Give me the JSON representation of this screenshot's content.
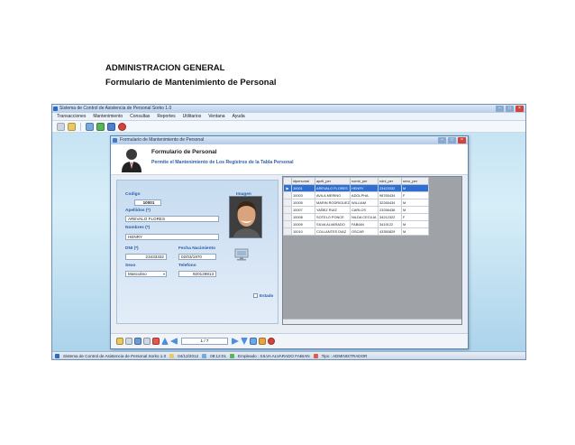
{
  "document": {
    "heading": "ADMINISTRACION GENERAL",
    "subheading": "Formulario de Mantenimiento de Personal"
  },
  "app": {
    "title": "Sistema de Control de Asistencia de Personal Sorko 1.0",
    "menu": [
      "Transacciones",
      "Mantenimiento",
      "Consultas",
      "Reportes",
      "Utilitarios",
      "Ventana",
      "Ayuda"
    ]
  },
  "form": {
    "window_title": "Formulario de Mantenimiento de Personal",
    "header_title": "Formulario de Personal",
    "header_subtitle": "Permite el Mantenimiento de Los Registros de la Tabla Personal",
    "labels": {
      "codigo": "Codigo",
      "apellidos": "Apellidos (*)",
      "nombres": "Nombres (*)",
      "dni": "DNI (*)",
      "fecha_nacimiento": "Fecha Nacimiento",
      "sexo": "Sexo",
      "telefono": "Telefono",
      "imagen": "Imagen",
      "estado": "Estado"
    },
    "values": {
      "codigo": "10001",
      "apellidos": "AREVALO FLORES",
      "nombres": "HENRY",
      "dni": "23433332",
      "fecha_nacimiento": "02/03/1970",
      "sexo": "Masculino",
      "telefono": "920129813"
    },
    "nav_counter": "1 / 7"
  },
  "grid": {
    "columns": [
      "idpersonal",
      "apell_per",
      "nomb_per",
      "ndni_per",
      "sexo_per"
    ],
    "rows": [
      [
        "10001",
        "AREVALO FLORES",
        "HENRY",
        "23423332",
        "M"
      ],
      [
        "10003",
        "AVILA MERINO",
        "ADOLPHA",
        "98765434",
        "F"
      ],
      [
        "10005",
        "MARIN RODRIGUEZ",
        "WILLIAM",
        "32265434",
        "M"
      ],
      [
        "10007",
        "YAÑEZ RUIZ",
        "CARLOS",
        "23256436",
        "M"
      ],
      [
        "10008",
        "SOTELO PONCE",
        "NILDA CECILIA",
        "34212322",
        "F"
      ],
      [
        "10009",
        "SILVA ALVARADO",
        "FABIAN",
        "3419122",
        "M"
      ],
      [
        "10010",
        "COLLANTES DIAZ",
        "OSCAR",
        "43350829",
        "M"
      ]
    ],
    "selected_row": 0,
    "row_marker": "▶"
  },
  "statusbar": {
    "app": "Sistema de Control de Asistencia de Personal Sorko 1.0",
    "date": "04/12/2012",
    "time": "08:12:01",
    "employee": "Empleado : SILVA ALVARADO FABIAN",
    "tipo": "Tipo : ADMINISTRADOR"
  },
  "colors": {
    "accent": "#2e63a8",
    "selection": "#2f6fd2",
    "close": "#d0443c"
  }
}
